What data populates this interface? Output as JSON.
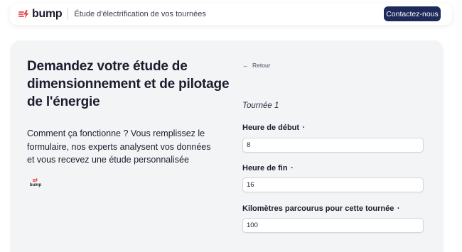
{
  "header": {
    "brand": "bump",
    "tagline": "Étude d'électrification de vos tournées",
    "contact_label": "Contactez-nous",
    "brand_color": "#e5484d",
    "button_color": "#1e2a5a"
  },
  "hero": {
    "title": "Demandez votre étude de dimensionnement et de pilotage de l'énergie",
    "description": "Comment ça fonctionne ? Vous remplissez le formulaire, nos experts analysent vos données et vous recevez une étude personnalisée",
    "mini_brand": "bump"
  },
  "form": {
    "back_label": "Retour",
    "back_icon": "arrow-left-icon",
    "tour_label": "Tournée 1",
    "required_mark": "•",
    "fields": [
      {
        "label": "Heure de début",
        "value": "8"
      },
      {
        "label": "Heure de fin",
        "value": "16"
      },
      {
        "label": "Kilomètres parcourus pour cette tournée",
        "value": "100"
      }
    ]
  }
}
